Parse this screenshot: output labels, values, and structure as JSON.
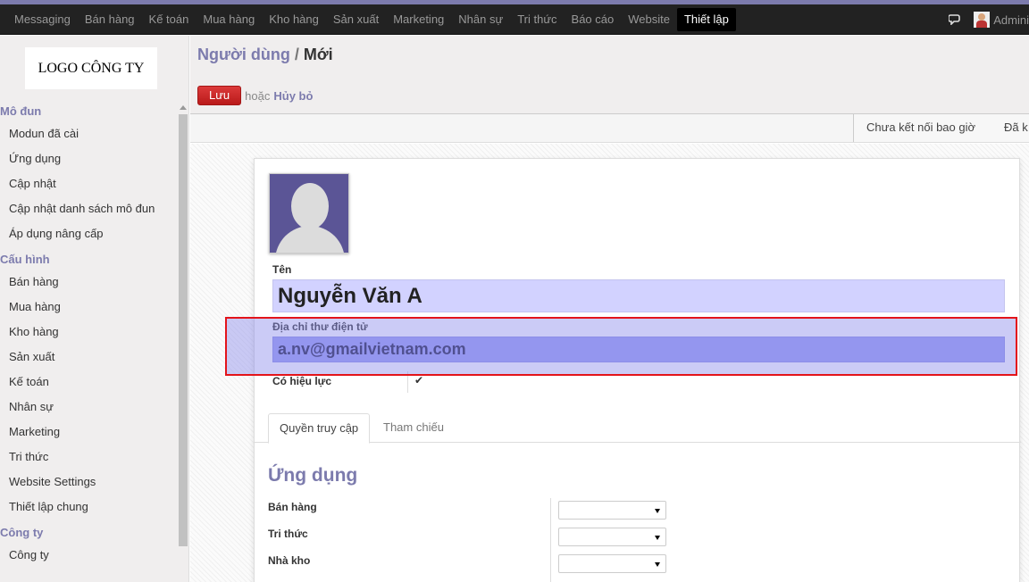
{
  "topnav": {
    "items": [
      "Messaging",
      "Bán hàng",
      "Kế toán",
      "Mua hàng",
      "Kho hàng",
      "Sản xuất",
      "Marketing",
      "Nhân sự",
      "Tri thức",
      "Báo cáo",
      "Website",
      "Thiết lập"
    ],
    "active_index": 11,
    "user_name": "Admini"
  },
  "sidebar": {
    "logo_text": "LOGO CÔNG TY",
    "sections": [
      {
        "title": "Mô đun",
        "items": [
          "Modun đã cài",
          "Ứng dụng",
          "Cập nhật",
          "Cập nhật danh sách mô đun",
          "Áp dụng nâng cấp"
        ]
      },
      {
        "title": "Cấu hình",
        "items": [
          "Bán hàng",
          "Mua hàng",
          "Kho hàng",
          "Sản xuất",
          "Kế toán",
          "Nhân sự",
          "Marketing",
          "Tri thức",
          "Website Settings",
          "Thiết lập chung"
        ]
      },
      {
        "title": "Công ty",
        "items": [
          "Công ty"
        ]
      }
    ]
  },
  "header": {
    "breadcrumb_parent": "Người dùng",
    "breadcrumb_sep": "/",
    "breadcrumb_current": "Mới",
    "save_label": "Lưu",
    "or_text": "hoặc",
    "cancel_label": "Hủy bỏ"
  },
  "statusbar": {
    "steps": [
      "Chưa kết nối bao giờ",
      "Đã k"
    ]
  },
  "form": {
    "name_label": "Tên",
    "name_value": "Nguyễn Văn A",
    "email_label": "Địa chỉ thư điện tử",
    "email_value": "a.nv@gmailvietnam.com",
    "active_label": "Có hiệu lực",
    "active_checked": true,
    "check_glyph": "✔"
  },
  "tabs": {
    "items": [
      "Quyền truy cập",
      "Tham chiếu"
    ],
    "active_index": 0
  },
  "applications": {
    "title": "Ứng dụng",
    "rows": [
      "Bán hàng",
      "Tri thức",
      "Nhà kho"
    ]
  },
  "colors": {
    "brand": "#7c7bad",
    "save_button": "#d21f1f",
    "highlight_border": "#e3141a",
    "name_field_bg": "#d2d2ff",
    "email_field_bg": "#9b9ff3"
  }
}
